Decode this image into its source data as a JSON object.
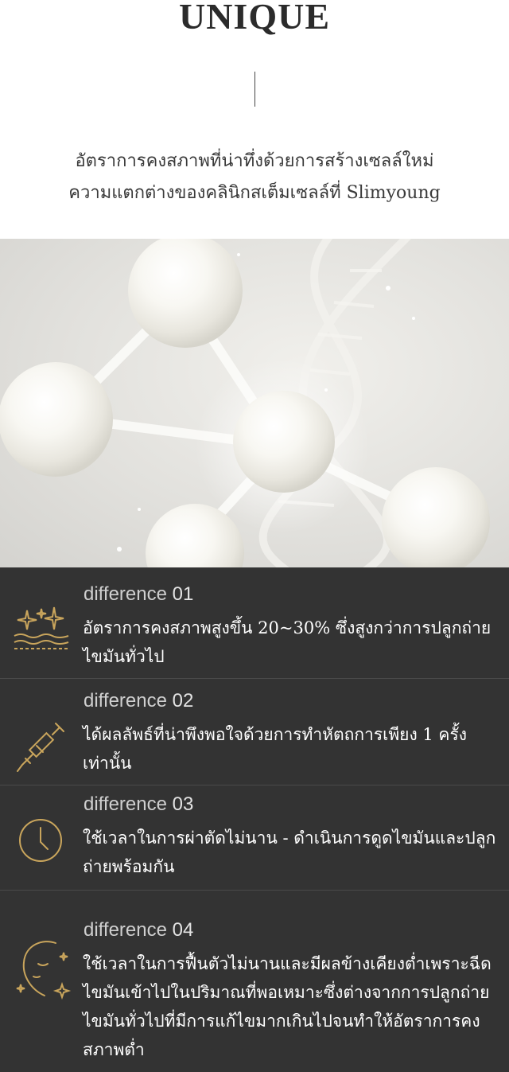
{
  "header": {
    "title": "UNIQUE",
    "subtitle_line1": "อัตราการคงสภาพที่น่าทึ่งด้วยการสร้างเซลล์ใหม่",
    "subtitle_line2": "ความแตกต่างของคลินิกสเต็มเซลล์ที่ Slimyoung"
  },
  "differences": [
    {
      "label": "difference",
      "number": "01",
      "icon": "sparkle-skin-icon",
      "text": "อัตราการคงสภาพสูงขึ้น 20~30% ซึ่งสูงกว่าการปลูกถ่ายไขมันทั่วไป"
    },
    {
      "label": "difference",
      "number": "02",
      "icon": "syringe-icon",
      "text": "ได้ผลลัพธ์ที่น่าพึงพอใจด้วยการทำหัตถการเพียง 1 ครั้งเท่านั้น"
    },
    {
      "label": "difference",
      "number": "03",
      "icon": "clock-icon",
      "text": "ใช้เวลาในการผ่าตัดไม่นาน - ดำเนินการดูดไขมันและปลูกถ่ายพร้อมกัน"
    },
    {
      "label": "difference",
      "number": "04",
      "icon": "face-sparkle-icon",
      "text": "ใช้เวลาในการฟื้นตัวไม่นานและมีผลข้างเคียงต่ำเพราะฉีดไขมันเข้าไปในปริมาณที่พอเหมาะซึ่งต่างจากการปลูกถ่ายไขมันทั่วไปที่มีการแก้ไขมากเกินไปจนทำให้อัตราการคงสภาพต่ำ"
    }
  ],
  "colors": {
    "dark_bg": "#333333",
    "gold": "#c9a55c",
    "text": "#ffffff"
  }
}
